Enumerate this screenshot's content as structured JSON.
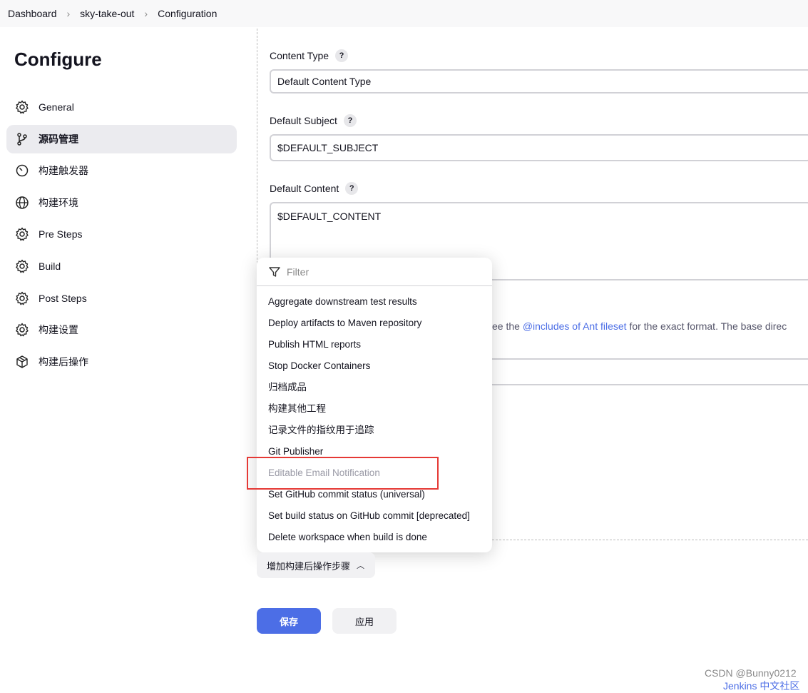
{
  "breadcrumb": [
    "Dashboard",
    "sky-take-out",
    "Configuration"
  ],
  "page_title": "Configure",
  "sidebar": {
    "items": [
      {
        "label": "General",
        "icon": "gear-icon"
      },
      {
        "label": "源码管理",
        "icon": "branch-icon",
        "active": true
      },
      {
        "label": "构建触发器",
        "icon": "timer-icon"
      },
      {
        "label": "构建环境",
        "icon": "globe-icon"
      },
      {
        "label": "Pre Steps",
        "icon": "gear-icon"
      },
      {
        "label": "Build",
        "icon": "gear-icon"
      },
      {
        "label": "Post Steps",
        "icon": "gear-icon"
      },
      {
        "label": "构建设置",
        "icon": "gear-icon"
      },
      {
        "label": "构建后操作",
        "icon": "package-icon"
      }
    ]
  },
  "form": {
    "content_type_label": "Content Type",
    "content_type_value": "Default Content Type",
    "subject_label": "Default Subject",
    "subject_value": "$DEFAULT_SUBJECT",
    "content_label": "Default Content",
    "content_value": "$DEFAULT_CONTENT",
    "help_pre": "ee the ",
    "help_link": "@includes of Ant fileset",
    "help_post": " for the exact format. The base direc",
    "help_icon": "?"
  },
  "menu": {
    "filter_placeholder": "Filter",
    "items": [
      "Aggregate downstream test results",
      "Deploy artifacts to Maven repository",
      "Publish HTML reports",
      "Stop Docker Containers",
      "归档成品",
      "构建其他工程",
      "记录文件的指纹用于追踪",
      "Git Publisher",
      "Editable Email Notification",
      "Set GitHub commit status (universal)",
      "Set build status on GitHub commit [deprecated]",
      "Delete workspace when build is done"
    ]
  },
  "add_step_label": "增加构建后操作步骤",
  "save_label": "保存",
  "apply_label": "应用",
  "watermark": "CSDN @Bunny0212",
  "footer_link": "Jenkins 中文社区",
  "colors": {
    "accent": "#4c6ee6",
    "highlight": "#e53935"
  }
}
